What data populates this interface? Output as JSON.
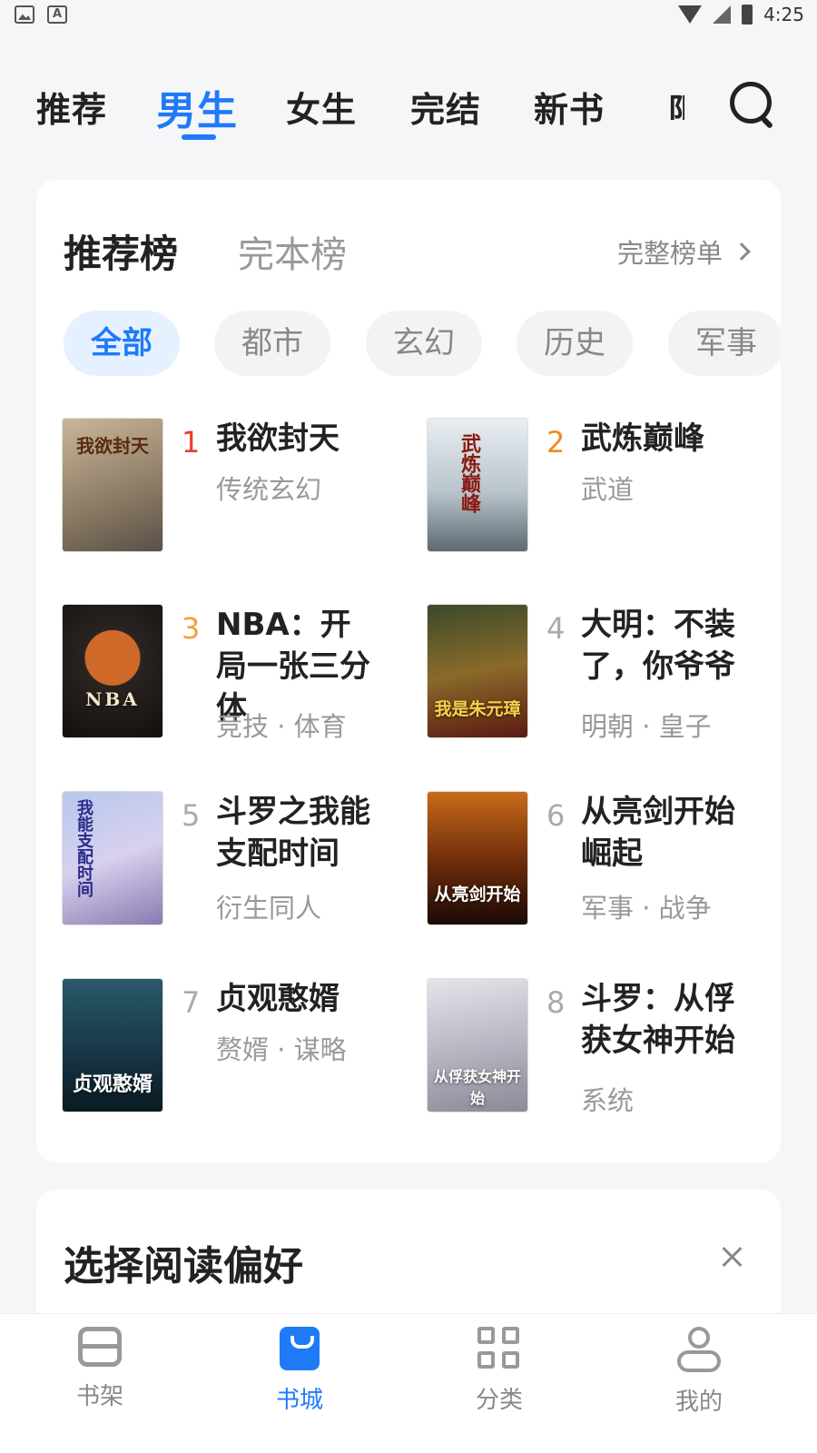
{
  "status_bar": {
    "time": "4:25",
    "left_icons": [
      "image-icon",
      "a-icon"
    ],
    "right_icons": [
      "wifi-icon",
      "no-signal-icon",
      "battery-charging-icon"
    ]
  },
  "top_tabs": {
    "items": [
      "推荐",
      "男生",
      "女生",
      "完结",
      "新书"
    ],
    "active": "男生",
    "partial_next": "限"
  },
  "ranking": {
    "tabs": [
      "推荐榜",
      "完本榜"
    ],
    "active_tab": "推荐榜",
    "more_label": "完整榜单",
    "chips": [
      "全部",
      "都市",
      "玄幻",
      "历史",
      "军事"
    ],
    "active_chip": "全部",
    "books": [
      {
        "rank": "1",
        "title": "我欲封天",
        "tags": "传统玄幻",
        "cover_text": "我欲封天"
      },
      {
        "rank": "2",
        "title": "武炼巅峰",
        "tags": "武道",
        "cover_text": "武炼巅峰"
      },
      {
        "rank": "3",
        "title": "NBA：开局一张三分体",
        "tags": "竞技 · 体育",
        "cover_text": "NBA"
      },
      {
        "rank": "4",
        "title": "大明：不装了，你爷爷",
        "tags": "明朝 · 皇子",
        "cover_text": "我是朱元璋"
      },
      {
        "rank": "5",
        "title": "斗罗之我能支配时间",
        "tags": "衍生同人",
        "cover_text": "我能支配时间"
      },
      {
        "rank": "6",
        "title": "从亮剑开始崛起",
        "tags": "军事 · 战争",
        "cover_text": "从亮剑开始"
      },
      {
        "rank": "7",
        "title": "贞观憨婿",
        "tags": "赘婿 · 谋略",
        "cover_text": "贞观憨婿"
      },
      {
        "rank": "8",
        "title": "斗罗：从俘获女神开始",
        "tags": "系统",
        "cover_text": "从俘获女神开始"
      }
    ],
    "rank_colors": {
      "1": "#e8402f",
      "2": "#f0891f",
      "3": "#f2a03a",
      "default": "#aaaaaa"
    }
  },
  "preference": {
    "title": "选择阅读偏好"
  },
  "bottom_nav": {
    "items": [
      {
        "label": "书架",
        "icon": "bookshelf-icon"
      },
      {
        "label": "书城",
        "icon": "bookstore-icon"
      },
      {
        "label": "分类",
        "icon": "category-icon"
      },
      {
        "label": "我的",
        "icon": "profile-icon"
      }
    ],
    "active": "书城"
  },
  "colors": {
    "accent": "#1f7af8"
  }
}
